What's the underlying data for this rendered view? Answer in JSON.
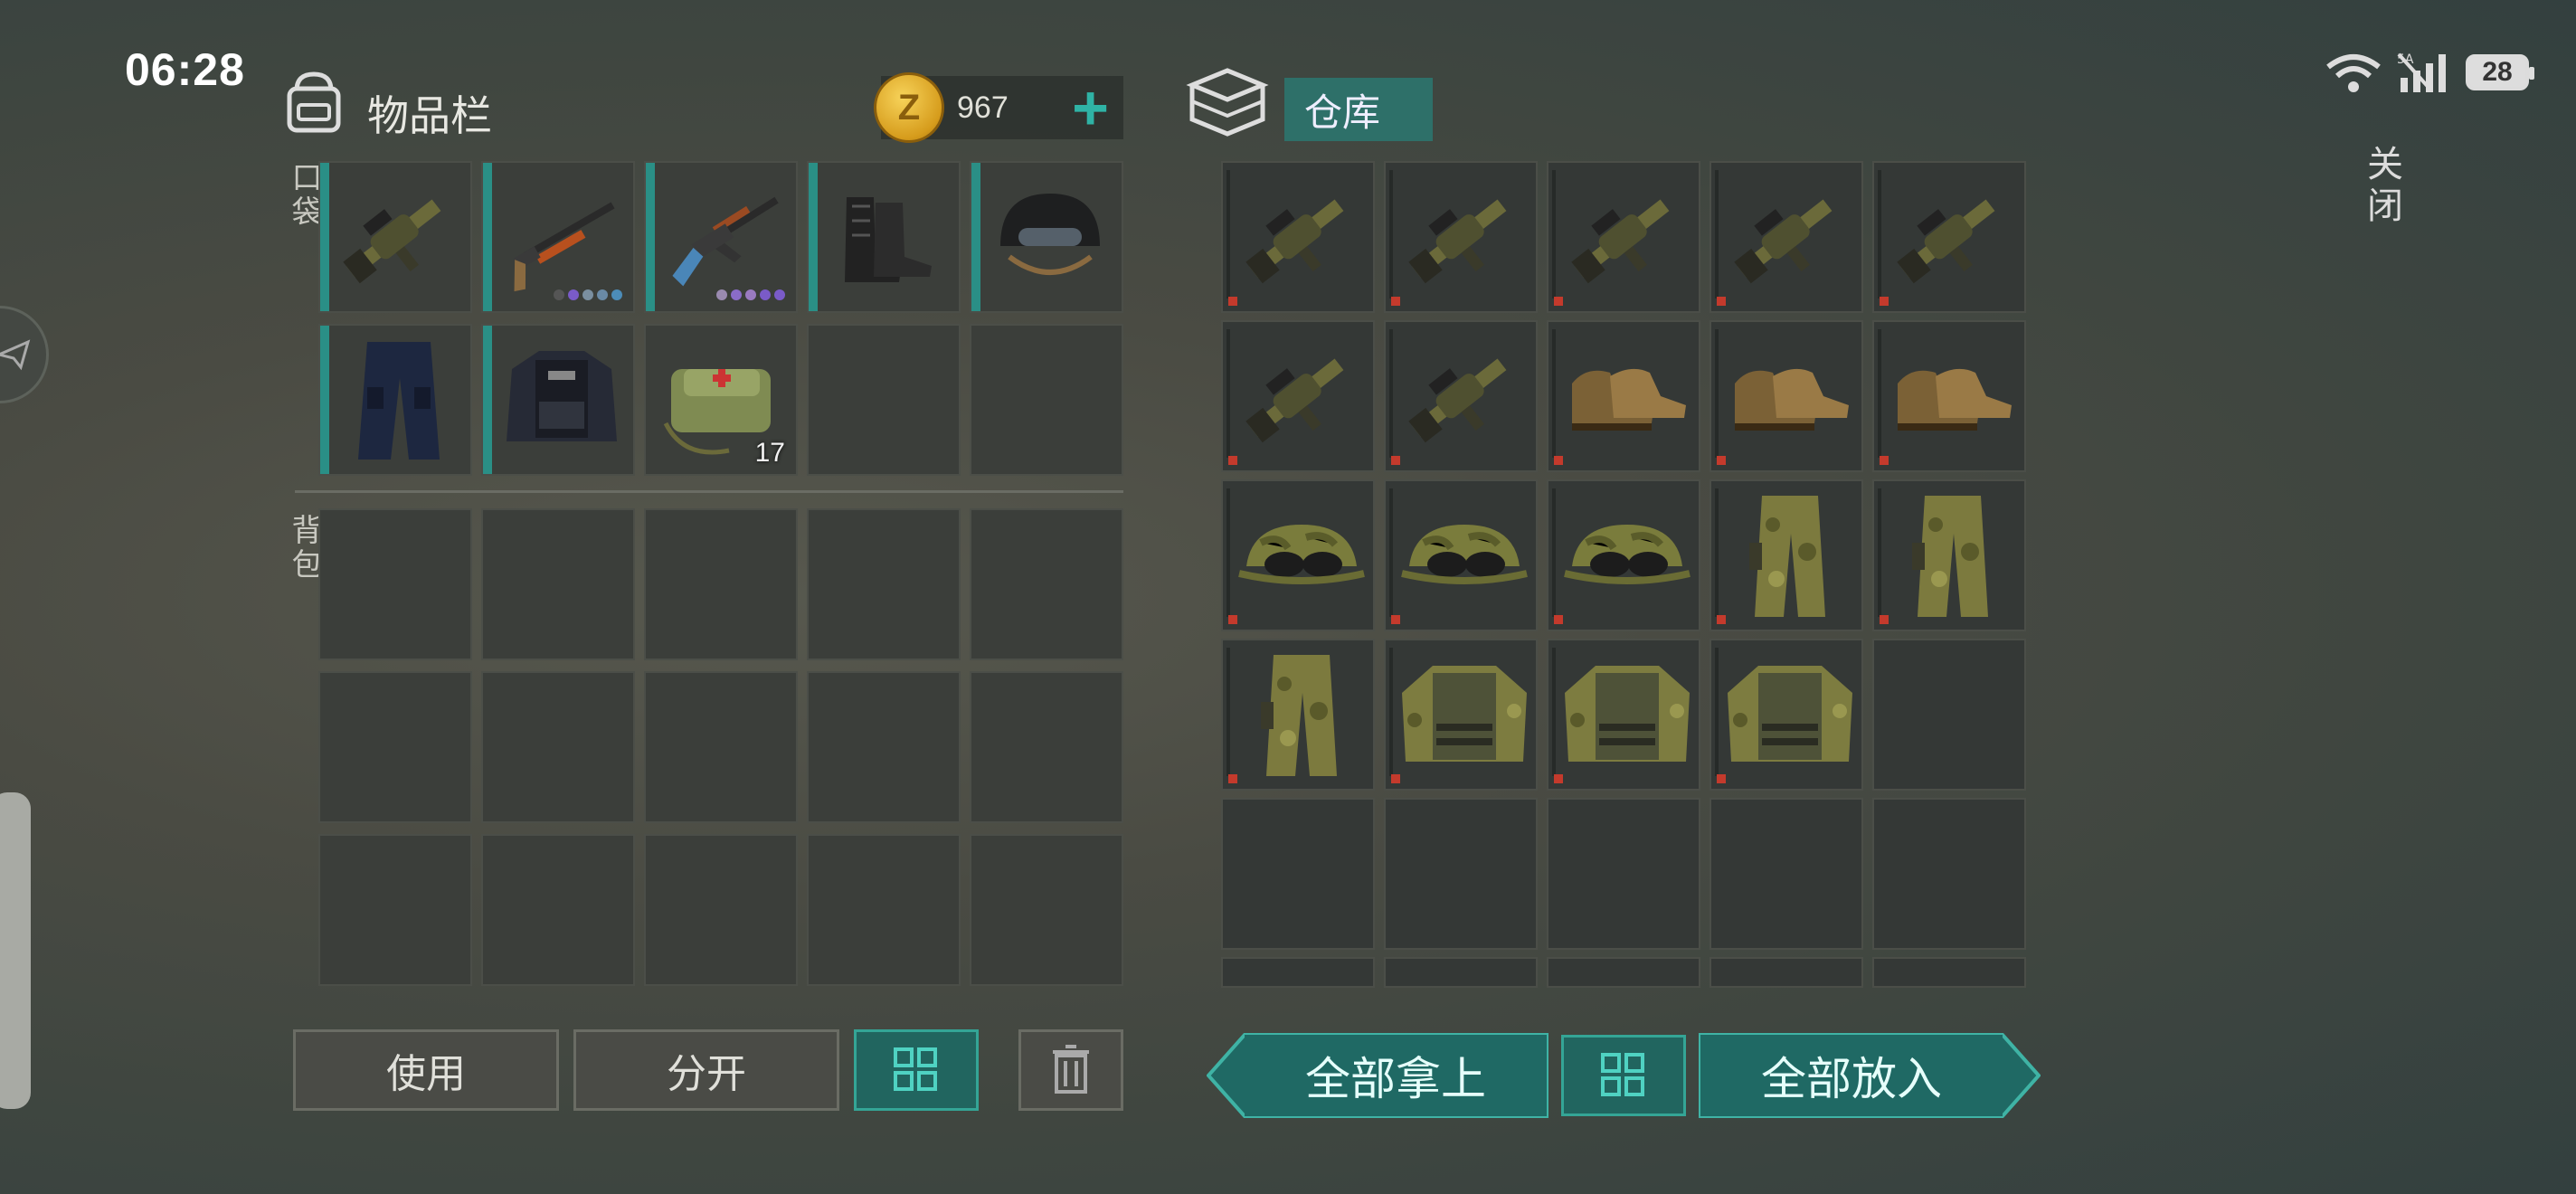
{
  "status_bar": {
    "time": "06:28",
    "network": "5A",
    "battery": "28"
  },
  "close_label": "关闭",
  "inventory": {
    "title": "物品栏",
    "coins": "967",
    "pocket_label": "口袋",
    "backpack_label": "背包",
    "medkit_qty": "17"
  },
  "storage": {
    "title": "仓库"
  },
  "buttons": {
    "use": "使用",
    "split": "分开",
    "take_all": "全部拿上",
    "put_all": "全部放入"
  },
  "icons": {
    "backpack": "backpack-icon",
    "storage": "storage-crate-icon",
    "coin": "z-coin-icon",
    "plus": "plus-icon",
    "sort": "sort-grid-icon",
    "trash": "trash-icon",
    "grenade_launcher": "grenade-launcher-icon",
    "shotgun": "shotgun-icon",
    "ak": "assault-rifle-icon",
    "boots_black": "black-boots-icon",
    "helmet": "helmet-icon",
    "pants_police": "police-pants-icon",
    "vest_police": "police-vest-icon",
    "medkit": "medkit-bag-icon",
    "boots_tan": "tan-boots-icon",
    "cap": "camo-cap-goggles-icon",
    "pants_camo": "camo-pants-icon",
    "jacket_camo": "camo-armor-jacket-icon"
  },
  "colors": {
    "accent": "#2fb3a5",
    "tab": "#2e7069",
    "durability_marker": "#c43a2c"
  }
}
